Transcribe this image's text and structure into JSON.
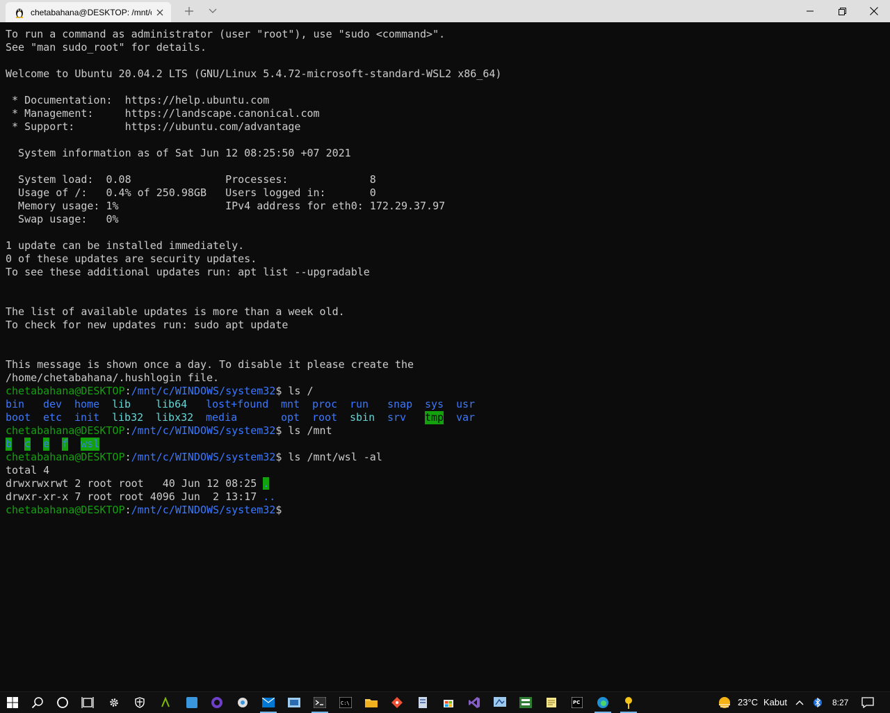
{
  "window": {
    "tab_title": "chetabahana@DESKTOP: /mnt/c",
    "tab_icon": "linux-penguin-icon",
    "new_tab_icon": "plus-icon",
    "dropdown_icon": "chevron-down-icon",
    "minimize_icon": "minimize-icon",
    "restore_icon": "restore-icon",
    "close_icon": "close-icon"
  },
  "terminal": {
    "motd": [
      "To run a command as administrator (user \"root\"), use \"sudo <command>\".",
      "See \"man sudo_root\" for details.",
      "",
      "Welcome to Ubuntu 20.04.2 LTS (GNU/Linux 5.4.72-microsoft-standard-WSL2 x86_64)",
      "",
      " * Documentation:  https://help.ubuntu.com",
      " * Management:     https://landscape.canonical.com",
      " * Support:        https://ubuntu.com/advantage",
      "",
      "  System information as of Sat Jun 12 08:25:50 +07 2021",
      "",
      "  System load:  0.08               Processes:             8",
      "  Usage of /:   0.4% of 250.98GB   Users logged in:       0",
      "  Memory usage: 1%                 IPv4 address for eth0: 172.29.37.97",
      "  Swap usage:   0%",
      "",
      "1 update can be installed immediately.",
      "0 of these updates are security updates.",
      "To see these additional updates run: apt list --upgradable",
      "",
      "",
      "The list of available updates is more than a week old.",
      "To check for new updates run: sudo apt update",
      "",
      "",
      "This message is shown once a day. To disable it please create the",
      "/home/chetabahana/.hushlogin file."
    ],
    "prompt_user": "chetabahana@DESKTOP",
    "prompt_colon": ":",
    "prompt_path": "/mnt/c/WINDOWS/system32",
    "prompt_dollar": "$",
    "cmd1": " ls /",
    "ls_root_row1": [
      "bin",
      "dev",
      "home",
      "lib",
      "lib64",
      "lost+found",
      "mnt",
      "proc",
      "run",
      "snap",
      "sys",
      "usr"
    ],
    "ls_root_row2": [
      "boot",
      "etc",
      "init",
      "lib32",
      "libx32",
      "media",
      "opt",
      "root",
      "sbin",
      "srv",
      "tmp",
      "var"
    ],
    "cmd2": " ls /mnt",
    "ls_mnt": [
      "b",
      "c",
      "e",
      "f",
      "wsl"
    ],
    "cmd3": " ls /mnt/wsl -al",
    "total": "total 4",
    "dir1": "drwxrwxrwt 2 root root   40 Jun 12 08:25 ",
    "dir1_name": ".",
    "dir2": "drwxr-xr-x 7 root root 4096 Jun  2 13:17 ",
    "dir2_name": ".."
  },
  "taskbar": {
    "icons": [
      "windows-start-icon",
      "search-icon",
      "cortana-icon",
      "task-view-icon",
      "settings-icon",
      "security-shield-icon",
      "app-icon",
      "app-icon",
      "github-icon",
      "app-icon",
      "mail-icon",
      "app-icon",
      "terminal-icon",
      "cmd-icon",
      "file-explorer-icon",
      "git-icon",
      "app-icon",
      "store-icon",
      "visual-studio-icon",
      "app-icon",
      "app-icon",
      "notepad-icon",
      "pycharm-icon",
      "edge-icon",
      "app-icon"
    ],
    "weather_icon": "weather-sun-fog-icon",
    "temperature": "23°C",
    "weather": "Kabut",
    "chevron_icon": "chevron-up-icon",
    "bluetooth_icon": "bluetooth-icon",
    "time": "8:27",
    "notification_icon": "notification-icon"
  }
}
